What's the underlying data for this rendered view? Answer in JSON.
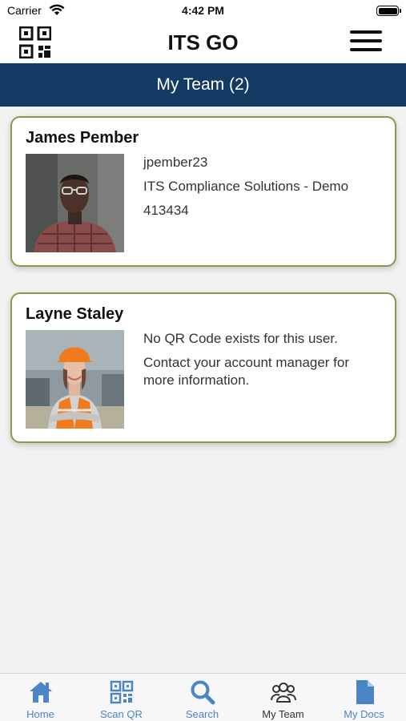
{
  "status_bar": {
    "carrier": "Carrier",
    "time": "4:42 PM"
  },
  "header": {
    "title": "ITS GO",
    "left_icon": "qr-code-icon",
    "right_icon": "hamburger-menu-icon"
  },
  "section": {
    "title": "My Team (2)",
    "background": "#123a63"
  },
  "team": [
    {
      "name": "James Pember",
      "lines": [
        "jpember23",
        "ITS Compliance Solutions - Demo",
        "413434"
      ]
    },
    {
      "name": "Layne Staley",
      "lines": [
        "No QR Code exists for this user.",
        "Contact your account manager for more information."
      ]
    }
  ],
  "tabs": [
    {
      "label": "Home",
      "icon": "home-icon",
      "active": false
    },
    {
      "label": "Scan QR",
      "icon": "qr-scan-icon",
      "active": false
    },
    {
      "label": "Search",
      "icon": "search-icon",
      "active": false
    },
    {
      "label": "My Team",
      "icon": "team-icon",
      "active": true
    },
    {
      "label": "My Docs",
      "icon": "document-icon",
      "active": false
    }
  ],
  "colors": {
    "accent": "#4a86c5",
    "card_border": "#8a9a4a",
    "active_tab": "#333333"
  }
}
